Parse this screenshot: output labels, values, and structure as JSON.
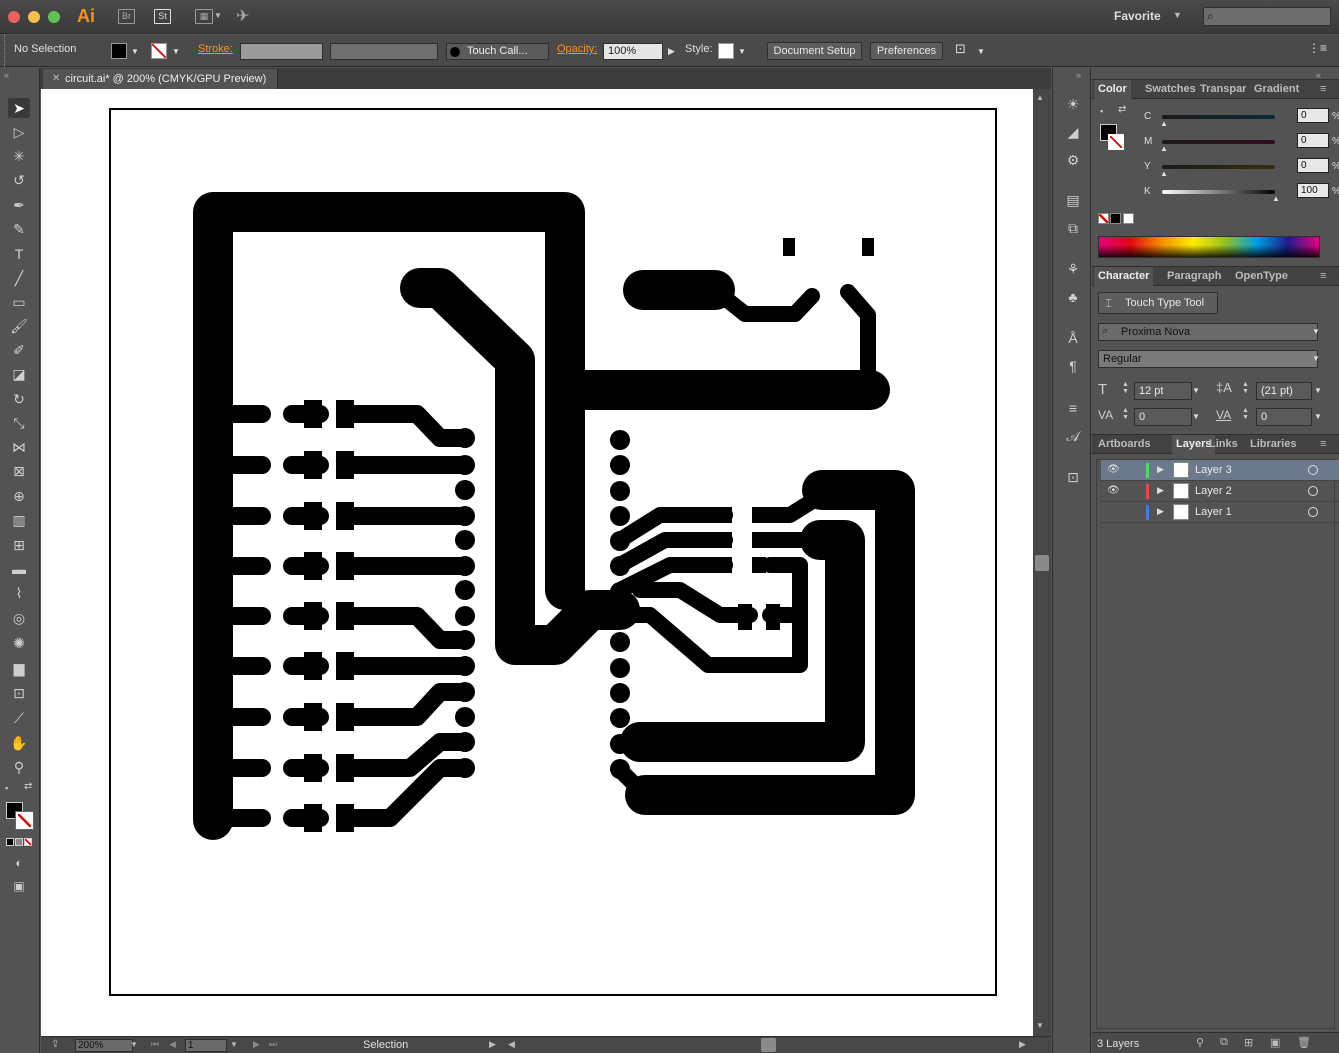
{
  "app": {
    "logo": "Ai",
    "workspace": "Favorite",
    "bridge_label": "Br",
    "stock_label": "St"
  },
  "control": {
    "selection": "No Selection",
    "stroke_label": "Stroke:",
    "brush_value": "Touch Call...",
    "opacity_label": "Opacity:",
    "opacity_value": "100%",
    "style_label": "Style:",
    "document_setup": "Document Setup",
    "preferences": "Preferences"
  },
  "document": {
    "tab_title": "circuit.ai* @ 200% (CMYK/GPU Preview)"
  },
  "status": {
    "zoom": "200%",
    "artboard": "1",
    "tool": "Selection"
  },
  "color_panel": {
    "tabs": [
      "Color",
      "Swatches",
      "Transpar",
      "Gradient"
    ],
    "channels": [
      {
        "label": "C",
        "value": "0"
      },
      {
        "label": "M",
        "value": "0"
      },
      {
        "label": "Y",
        "value": "0"
      },
      {
        "label": "K",
        "value": "100"
      }
    ],
    "percent": "%"
  },
  "character_panel": {
    "tabs": [
      "Character",
      "Paragraph",
      "OpenType"
    ],
    "touch_type": "Touch Type Tool",
    "font": "Proxima Nova",
    "style": "Regular",
    "size": "12 pt",
    "leading": "(21 pt)",
    "kerning": "0",
    "tracking": "0"
  },
  "layers_panel": {
    "tabs": [
      "Artboards",
      "Layers",
      "Links",
      "Libraries"
    ],
    "layers": [
      {
        "name": "Layer 3",
        "color": "#4cd964",
        "visible": true,
        "selected": true
      },
      {
        "name": "Layer 2",
        "color": "#e04a4a",
        "visible": true,
        "selected": false
      },
      {
        "name": "Layer 1",
        "color": "#4a7ae0",
        "visible": false,
        "selected": false
      }
    ],
    "count": "3 Layers"
  },
  "colors": {
    "accent": "#f7941e",
    "panel": "#535353",
    "dark": "#3a3a3a"
  }
}
